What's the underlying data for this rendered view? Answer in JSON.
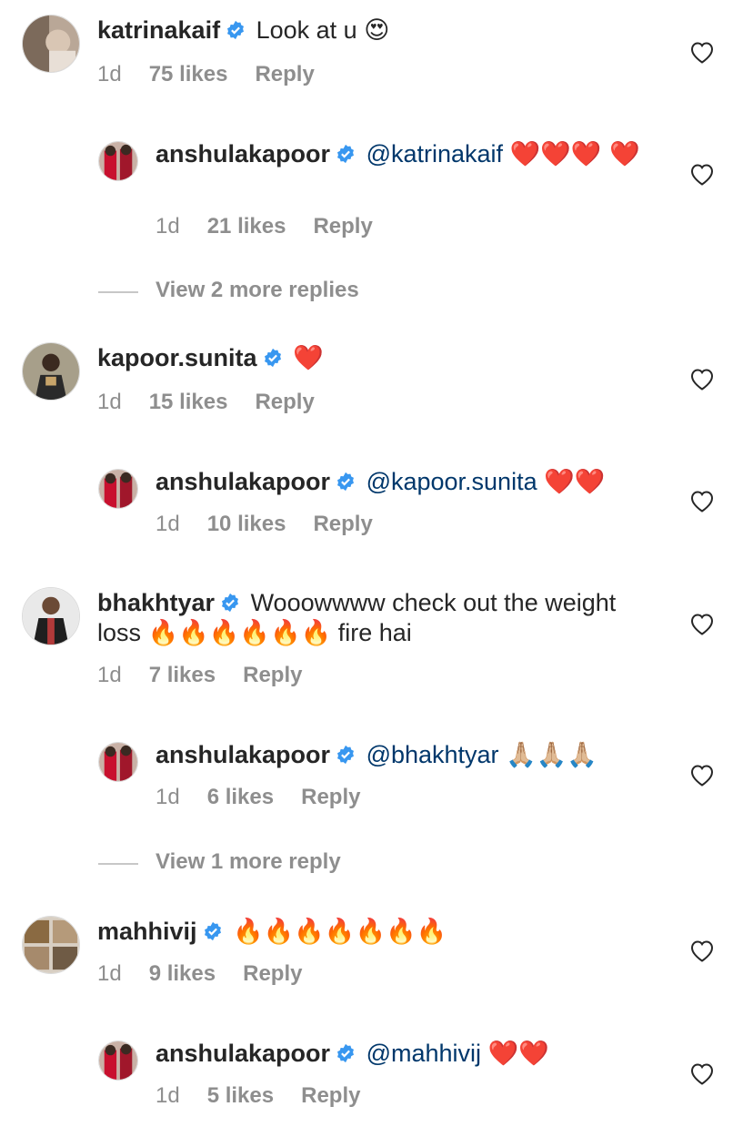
{
  "comments": [
    {
      "username": "katrinakaif",
      "text": "Look at u",
      "emoji": "😍",
      "time": "1d",
      "likes": "75 likes",
      "reply_label": "Reply",
      "replies": [
        {
          "username": "anshulakapoor",
          "mention": "@katrinakaif",
          "emoji": "❤️❤️❤️ ❤️",
          "time": "1d",
          "likes": "21 likes",
          "reply_label": "Reply"
        }
      ],
      "view_more": "View 2 more replies"
    },
    {
      "username": "kapoor.sunita",
      "text": "",
      "emoji": "❤️",
      "time": "1d",
      "likes": "15 likes",
      "reply_label": "Reply",
      "replies": [
        {
          "username": "anshulakapoor",
          "mention": "@kapoor.sunita",
          "emoji": "❤️❤️",
          "time": "1d",
          "likes": "10 likes",
          "reply_label": "Reply"
        }
      ],
      "view_more": ""
    },
    {
      "username": "bhakhtyar",
      "text": "Wooowwww check out the weight loss",
      "emoji": "🔥🔥🔥🔥🔥🔥",
      "text_after": "fire hai",
      "time": "1d",
      "likes": "7 likes",
      "reply_label": "Reply",
      "replies": [
        {
          "username": "anshulakapoor",
          "mention": "@bhakhtyar",
          "emoji": "🙏🏼🙏🏼🙏🏼",
          "time": "1d",
          "likes": "6 likes",
          "reply_label": "Reply"
        }
      ],
      "view_more": "View 1 more reply"
    },
    {
      "username": "mahhivij",
      "text": "",
      "emoji": "🔥🔥🔥🔥🔥🔥🔥",
      "time": "1d",
      "likes": "9 likes",
      "reply_label": "Reply",
      "replies": [
        {
          "username": "anshulakapoor",
          "mention": "@mahhivij",
          "emoji": "❤️❤️",
          "time": "1d",
          "likes": "5 likes",
          "reply_label": "Reply"
        }
      ],
      "view_more": ""
    }
  ],
  "colors": {
    "verified": "#3897f0",
    "mention": "#00376b",
    "meta": "#8e8e8e"
  },
  "icons": {
    "verified": "verified-badge-icon",
    "like": "heart-outline-icon"
  }
}
